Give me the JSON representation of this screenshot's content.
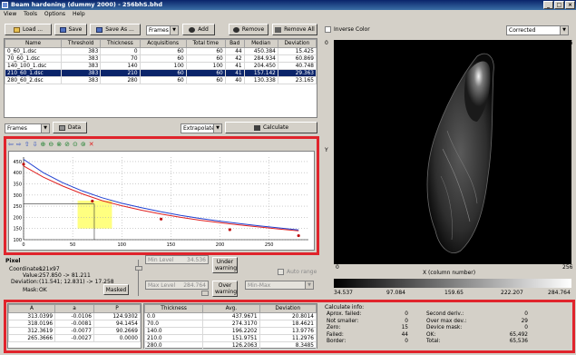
{
  "window": {
    "title": "Beam hardening (dummy 2000) - 256bhS.bhd",
    "controls": [
      "_",
      "□",
      "×"
    ]
  },
  "menu": [
    "View",
    "Tools",
    "Options",
    "Help"
  ],
  "toolbar": {
    "load": "Load ...",
    "save": "Save",
    "save_as": "Save As ...",
    "frames_combo": "Frames",
    "add": "Add",
    "remove": "Remove",
    "remove_all": "Remove All",
    "inverse_color": "Inverse Color",
    "mode_combo": "Corrected"
  },
  "file_table": {
    "columns": [
      "Name",
      "Threshold",
      "Thickness",
      "Acquisitions",
      "Total time",
      "Bad",
      "Median",
      "Deviation"
    ],
    "rows": [
      [
        "0_60_1.dsc",
        "383",
        "0",
        "60",
        "60",
        "44",
        "450.384",
        "15.425"
      ],
      [
        "70_60_1.dsc",
        "383",
        "70",
        "60",
        "60",
        "42",
        "284.934",
        "60.869"
      ],
      [
        "140_100_1.dsc",
        "383",
        "140",
        "100",
        "100",
        "41",
        "204.450",
        "40.748"
      ],
      [
        "210_60_1.dsc",
        "383",
        "210",
        "60",
        "60",
        "41",
        "157.142",
        "29.363"
      ],
      [
        "280_60_2.dsc",
        "383",
        "280",
        "60",
        "60",
        "40",
        "130.338",
        "23.165"
      ]
    ],
    "selected_index": 3
  },
  "mid_controls": {
    "frames": "Frames",
    "data": "Data",
    "extrapolate": "Extrapolate",
    "calculate": "Calculate"
  },
  "chart_data": {
    "type": "line",
    "x": [
      0,
      70,
      140,
      210,
      280
    ],
    "y_points": [
      450.384,
      284.934,
      204.45,
      157.142,
      130.338
    ],
    "series": [
      {
        "values_x": [
          0,
          20,
          40,
          60,
          80,
          100,
          120,
          140,
          160,
          180,
          200,
          220,
          240,
          260,
          280
        ],
        "values_y": [
          430,
          380,
          340,
          305,
          275,
          252,
          232,
          215,
          200,
          187,
          176,
          166,
          157,
          148,
          140
        ],
        "color": "#e02020"
      },
      {
        "values_x": [
          0,
          20,
          40,
          60,
          80,
          100,
          120,
          140,
          160,
          180,
          200,
          220,
          240,
          260,
          280
        ],
        "values_y": [
          460,
          400,
          355,
          318,
          288,
          263,
          243,
          225,
          209,
          195,
          183,
          172,
          162,
          153,
          144
        ],
        "color": "#2040d0"
      }
    ],
    "xlim": [
      0,
      290
    ],
    "ylim": [
      100,
      470
    ],
    "xticks": [
      "0",
      "50",
      "100",
      "150",
      "200",
      "250"
    ],
    "xtick_values": [
      0,
      50,
      100,
      150,
      200,
      250
    ],
    "yticks": [
      "100",
      "150",
      "200",
      "250",
      "300",
      "350",
      "400",
      "450"
    ],
    "ytick_values": [
      100,
      150,
      200,
      250,
      300,
      350,
      400,
      450
    ],
    "highlight": {
      "x_from": 55,
      "x_to": 90,
      "y_from": 150,
      "y_to": 275,
      "color": "#ffff80"
    },
    "crosshair": {
      "x": 72,
      "y": 260
    },
    "grid": true
  },
  "pixel_info": {
    "header": "Pixel",
    "coordinates_label": "Coordinates:",
    "coordinates": "121x97",
    "value_label": "Value:",
    "value": "257.850 -> 81.211",
    "deviation_label": "Deviation:",
    "deviation": "(11.541; 12.831) -> 17.258",
    "mask_label": "Mask:",
    "mask": "OK",
    "masked_button": "Masked"
  },
  "levels": {
    "min_label": "Min Level",
    "min_value": "34.536",
    "max_label": "Max Level",
    "max_value": "284.764",
    "under_warning": "Under warning",
    "over_warning": "Over warning",
    "auto_range": "Auto range",
    "min_max": "Min-Max"
  },
  "image_view": {
    "axis_top_right": "256",
    "axis_zero_top": "0",
    "axis_y": "Y",
    "axis_bottom_left": "0",
    "axis_bottom_right": "256",
    "x_label": "X (column number)",
    "colorbar_ticks": [
      "34.537",
      "97.084",
      "159.65",
      "222.207",
      "284.764"
    ]
  },
  "coef_table": {
    "columns": [
      "A",
      "a",
      "P"
    ],
    "rows": [
      [
        "313.0399",
        "-0.0106",
        "124.9302"
      ],
      [
        "318.0196",
        "-0.0081",
        "94.1454"
      ],
      [
        "312.3619",
        "-0.0077",
        "90.2669"
      ],
      [
        "265.3666",
        "-0.0027",
        "0.0000"
      ]
    ]
  },
  "thick_table": {
    "columns": [
      "Thickness",
      "Avg.",
      "Deviation"
    ],
    "rows": [
      [
        "0.0",
        "437.9671",
        "20.8014"
      ],
      [
        "70.0",
        "274.3170",
        "18.4621"
      ],
      [
        "140.0",
        "196.2202",
        "13.9776"
      ],
      [
        "210.0",
        "151.9751",
        "11.2976"
      ],
      [
        "280.0",
        "126.2063",
        "8.3485"
      ]
    ]
  },
  "calc_info": {
    "header": "Calculate info:",
    "left": [
      [
        "Aprox. failed:",
        "0"
      ],
      [
        "Not smaller:",
        "0"
      ],
      [
        "Zero:",
        "15"
      ],
      [
        "Failed:",
        "44"
      ],
      [
        "Border:",
        "0"
      ]
    ],
    "right": [
      [
        "Second deriv.:",
        "0"
      ],
      [
        "Over max dev.:",
        "29"
      ],
      [
        "Device mask:",
        "0"
      ],
      [
        "OK:",
        "65,492"
      ],
      [
        "Total:",
        "65,536"
      ]
    ]
  }
}
